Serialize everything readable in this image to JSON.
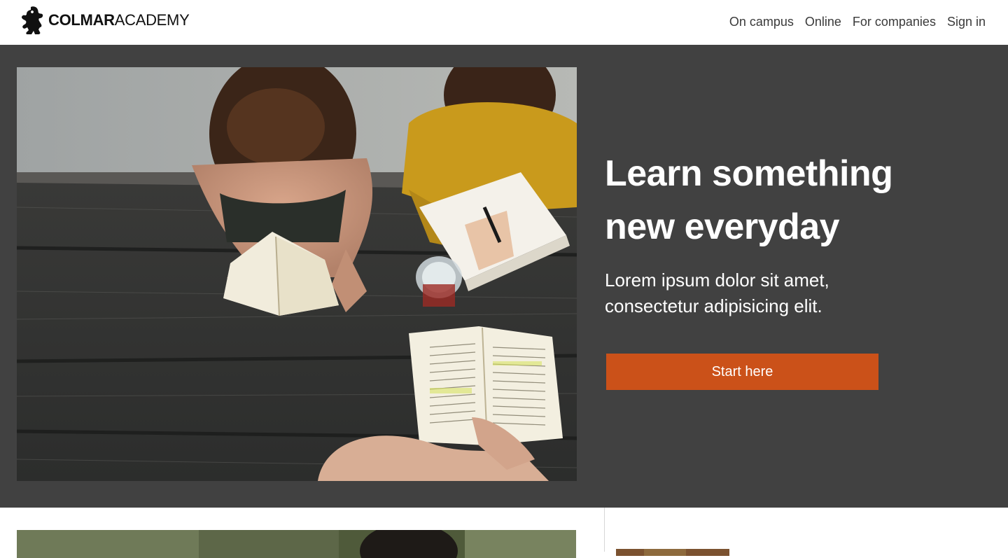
{
  "header": {
    "logo": {
      "bold": "COLMAR",
      "light": "ACADEMY",
      "icon": "lion-icon"
    },
    "nav": [
      "On campus",
      "Online",
      "For companies",
      "Sign in"
    ]
  },
  "hero": {
    "title_line1": "Learn something",
    "title_line2": "new everyday",
    "subtitle_line1": "Lorem ipsum dolor sit amet,",
    "subtitle_line2": "consectetur adipisicing elit.",
    "cta_label": "Start here",
    "photo": "students-studying-photo"
  },
  "colors": {
    "hero_bg": "#414141",
    "accent": "#cb5119",
    "nav_text": "#3a3a3a"
  }
}
